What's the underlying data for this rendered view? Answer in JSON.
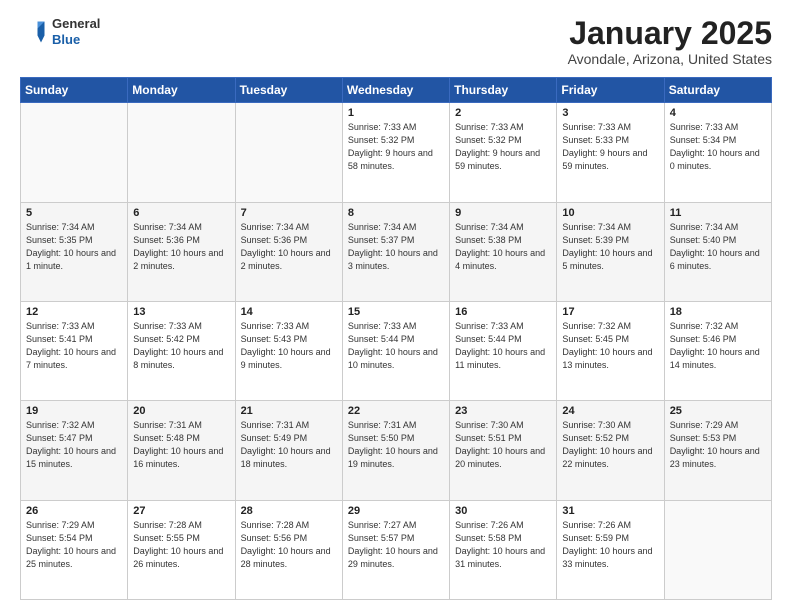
{
  "header": {
    "logo_general": "General",
    "logo_blue": "Blue",
    "month_title": "January 2025",
    "location": "Avondale, Arizona, United States"
  },
  "weekdays": [
    "Sunday",
    "Monday",
    "Tuesday",
    "Wednesday",
    "Thursday",
    "Friday",
    "Saturday"
  ],
  "weeks": [
    [
      {
        "day": "",
        "info": ""
      },
      {
        "day": "",
        "info": ""
      },
      {
        "day": "",
        "info": ""
      },
      {
        "day": "1",
        "info": "Sunrise: 7:33 AM\nSunset: 5:32 PM\nDaylight: 9 hours\nand 58 minutes."
      },
      {
        "day": "2",
        "info": "Sunrise: 7:33 AM\nSunset: 5:32 PM\nDaylight: 9 hours\nand 59 minutes."
      },
      {
        "day": "3",
        "info": "Sunrise: 7:33 AM\nSunset: 5:33 PM\nDaylight: 9 hours\nand 59 minutes."
      },
      {
        "day": "4",
        "info": "Sunrise: 7:33 AM\nSunset: 5:34 PM\nDaylight: 10 hours\nand 0 minutes."
      }
    ],
    [
      {
        "day": "5",
        "info": "Sunrise: 7:34 AM\nSunset: 5:35 PM\nDaylight: 10 hours\nand 1 minute."
      },
      {
        "day": "6",
        "info": "Sunrise: 7:34 AM\nSunset: 5:36 PM\nDaylight: 10 hours\nand 2 minutes."
      },
      {
        "day": "7",
        "info": "Sunrise: 7:34 AM\nSunset: 5:36 PM\nDaylight: 10 hours\nand 2 minutes."
      },
      {
        "day": "8",
        "info": "Sunrise: 7:34 AM\nSunset: 5:37 PM\nDaylight: 10 hours\nand 3 minutes."
      },
      {
        "day": "9",
        "info": "Sunrise: 7:34 AM\nSunset: 5:38 PM\nDaylight: 10 hours\nand 4 minutes."
      },
      {
        "day": "10",
        "info": "Sunrise: 7:34 AM\nSunset: 5:39 PM\nDaylight: 10 hours\nand 5 minutes."
      },
      {
        "day": "11",
        "info": "Sunrise: 7:34 AM\nSunset: 5:40 PM\nDaylight: 10 hours\nand 6 minutes."
      }
    ],
    [
      {
        "day": "12",
        "info": "Sunrise: 7:33 AM\nSunset: 5:41 PM\nDaylight: 10 hours\nand 7 minutes."
      },
      {
        "day": "13",
        "info": "Sunrise: 7:33 AM\nSunset: 5:42 PM\nDaylight: 10 hours\nand 8 minutes."
      },
      {
        "day": "14",
        "info": "Sunrise: 7:33 AM\nSunset: 5:43 PM\nDaylight: 10 hours\nand 9 minutes."
      },
      {
        "day": "15",
        "info": "Sunrise: 7:33 AM\nSunset: 5:44 PM\nDaylight: 10 hours\nand 10 minutes."
      },
      {
        "day": "16",
        "info": "Sunrise: 7:33 AM\nSunset: 5:44 PM\nDaylight: 10 hours\nand 11 minutes."
      },
      {
        "day": "17",
        "info": "Sunrise: 7:32 AM\nSunset: 5:45 PM\nDaylight: 10 hours\nand 13 minutes."
      },
      {
        "day": "18",
        "info": "Sunrise: 7:32 AM\nSunset: 5:46 PM\nDaylight: 10 hours\nand 14 minutes."
      }
    ],
    [
      {
        "day": "19",
        "info": "Sunrise: 7:32 AM\nSunset: 5:47 PM\nDaylight: 10 hours\nand 15 minutes."
      },
      {
        "day": "20",
        "info": "Sunrise: 7:31 AM\nSunset: 5:48 PM\nDaylight: 10 hours\nand 16 minutes."
      },
      {
        "day": "21",
        "info": "Sunrise: 7:31 AM\nSunset: 5:49 PM\nDaylight: 10 hours\nand 18 minutes."
      },
      {
        "day": "22",
        "info": "Sunrise: 7:31 AM\nSunset: 5:50 PM\nDaylight: 10 hours\nand 19 minutes."
      },
      {
        "day": "23",
        "info": "Sunrise: 7:30 AM\nSunset: 5:51 PM\nDaylight: 10 hours\nand 20 minutes."
      },
      {
        "day": "24",
        "info": "Sunrise: 7:30 AM\nSunset: 5:52 PM\nDaylight: 10 hours\nand 22 minutes."
      },
      {
        "day": "25",
        "info": "Sunrise: 7:29 AM\nSunset: 5:53 PM\nDaylight: 10 hours\nand 23 minutes."
      }
    ],
    [
      {
        "day": "26",
        "info": "Sunrise: 7:29 AM\nSunset: 5:54 PM\nDaylight: 10 hours\nand 25 minutes."
      },
      {
        "day": "27",
        "info": "Sunrise: 7:28 AM\nSunset: 5:55 PM\nDaylight: 10 hours\nand 26 minutes."
      },
      {
        "day": "28",
        "info": "Sunrise: 7:28 AM\nSunset: 5:56 PM\nDaylight: 10 hours\nand 28 minutes."
      },
      {
        "day": "29",
        "info": "Sunrise: 7:27 AM\nSunset: 5:57 PM\nDaylight: 10 hours\nand 29 minutes."
      },
      {
        "day": "30",
        "info": "Sunrise: 7:26 AM\nSunset: 5:58 PM\nDaylight: 10 hours\nand 31 minutes."
      },
      {
        "day": "31",
        "info": "Sunrise: 7:26 AM\nSunset: 5:59 PM\nDaylight: 10 hours\nand 33 minutes."
      },
      {
        "day": "",
        "info": ""
      }
    ]
  ]
}
